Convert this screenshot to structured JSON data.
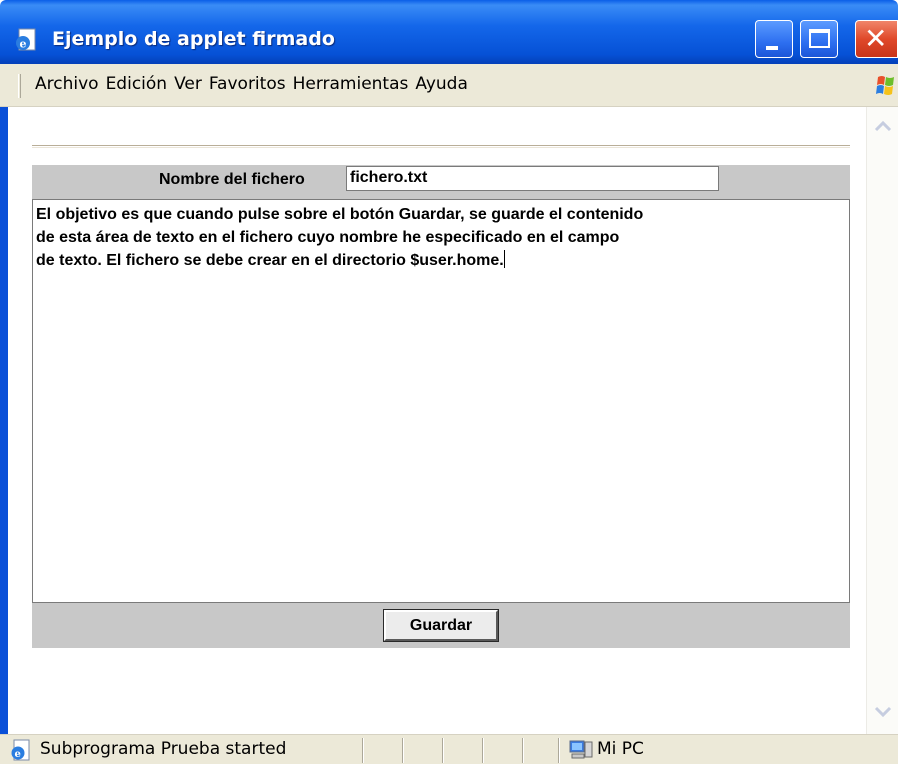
{
  "window": {
    "title": "Ejemplo de applet firmado"
  },
  "menubar": {
    "items": [
      "Archivo",
      "Edición",
      "Ver",
      "Favoritos",
      "Herramientas",
      "Ayuda"
    ]
  },
  "applet": {
    "filename_label": "Nombre del fichero",
    "filename_value": "fichero.txt",
    "textarea_lines": [
      "El objetivo es que cuando pulse sobre el botón Guardar, se guarde el contenido",
      "de esta área de texto en el fichero cuyo nombre he especificado en el campo",
      "de texto. El fichero se debe crear en el directorio $user.home."
    ],
    "save_label": "Guardar"
  },
  "statusbar": {
    "status_text": "Subprograma Prueba started",
    "zone_text": "Mi PC"
  },
  "icons": {
    "app": "ie-page-icon",
    "minimize": "minimize-icon",
    "maximize": "maximize-icon",
    "close": "close-icon",
    "windows_flag": "windows-flag-icon",
    "scroll_up": "scroll-up-icon",
    "scroll_down": "scroll-down-icon",
    "status": "ie-icon",
    "zone": "computer-icon"
  },
  "colors": {
    "titlebar": "#0a5ee8",
    "close_button": "#e0492a",
    "chrome": "#ece9d8",
    "applet_bg": "#c8c8c8"
  }
}
